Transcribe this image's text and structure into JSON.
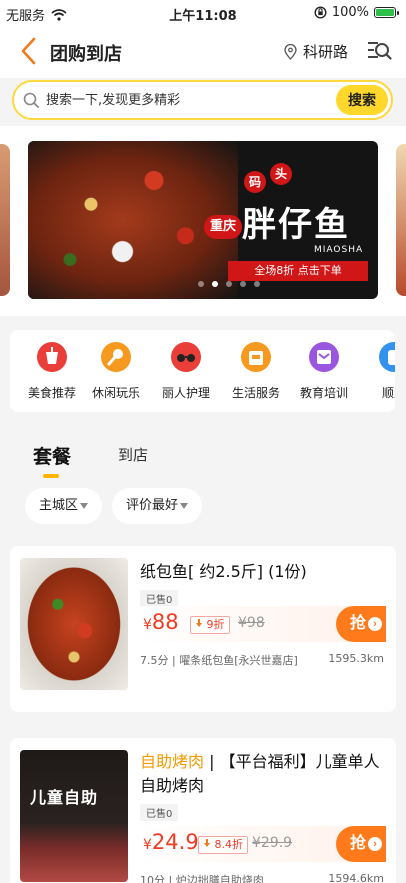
{
  "status_bar": {
    "carrier": "无服务",
    "time": "上午11:08",
    "battery_percent": "100%",
    "battery_level": 1.0
  },
  "header": {
    "title": "团购到店",
    "location": "科研路"
  },
  "search": {
    "placeholder": "搜索一下,发现更多精彩",
    "button_label": "搜索"
  },
  "banner": {
    "badge_1": "码",
    "badge_2": "头",
    "city": "重庆",
    "name": "胖仔鱼",
    "english": "MIAOSHA",
    "offer": "全场8折 点击下单",
    "slide_count": 5,
    "active_slide": 1
  },
  "categories": [
    {
      "label": "美食推荐",
      "icon": "cup-icon",
      "color": "#ea3e38"
    },
    {
      "label": "休闲玩乐",
      "icon": "microphone-icon",
      "color": "#f59a1e"
    },
    {
      "label": "丽人护理",
      "icon": "glasses-icon",
      "color": "#ea3e38"
    },
    {
      "label": "生活服务",
      "icon": "home-service-icon",
      "color": "#f59a1e"
    },
    {
      "label": "教育培训",
      "icon": "book-icon",
      "color": "#9a56df"
    },
    {
      "label": "顺风",
      "icon": "car-icon",
      "color": "#3392f0"
    }
  ],
  "tabs": [
    {
      "label": "套餐",
      "active": true
    },
    {
      "label": "到店",
      "active": false
    }
  ],
  "filters": [
    {
      "label": "主城区"
    },
    {
      "label": "评价最好"
    }
  ],
  "deals": [
    {
      "title_highlight": "",
      "title": "纸包鱼[ 约2.5斤] (1份)",
      "sold": "已售0",
      "price_symbol": "¥",
      "price": "88",
      "discount_icon": "down-arrow-icon",
      "discount": "9折",
      "original_price": "¥98",
      "grab_label": "抢",
      "meta": "7.5分 | 嚁条纸包鱼[永兴世嘉店]",
      "distance": "1595.3km"
    },
    {
      "title_highlight": "自助烤肉",
      "title": " | 【平台福利】儿童单人自助烤肉",
      "sold": "已售0",
      "price_symbol": "¥",
      "price": "24.9",
      "discount_icon": "down-arrow-icon",
      "discount": "8.4折",
      "original_price": "¥29.9",
      "grab_label": "抢",
      "meta": "10分 | 炉边拙膳自助烧肉",
      "distance": "1594.6km",
      "thumb_text": "儿童自助"
    }
  ]
}
